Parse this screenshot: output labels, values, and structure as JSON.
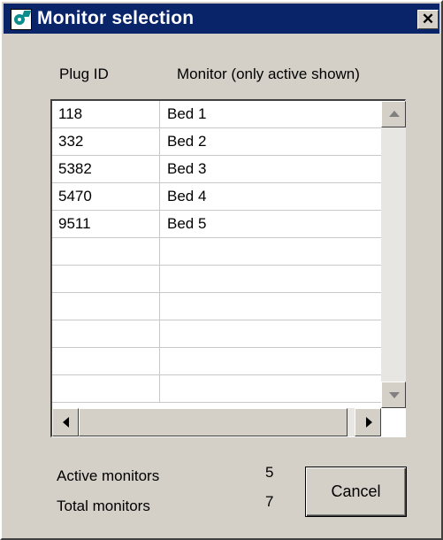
{
  "window": {
    "title": "Monitor selection",
    "close_label": "✕"
  },
  "table": {
    "headers": [
      "Plug ID",
      "Monitor (only active shown)"
    ],
    "rows": [
      {
        "plug_id": "118",
        "monitor": "Bed 1"
      },
      {
        "plug_id": "332",
        "monitor": "Bed 2"
      },
      {
        "plug_id": "5382",
        "monitor": "Bed 3"
      },
      {
        "plug_id": "5470",
        "monitor": "Bed 4"
      },
      {
        "plug_id": "9511",
        "monitor": "Bed 5"
      },
      {
        "plug_id": "",
        "monitor": ""
      },
      {
        "plug_id": "",
        "monitor": ""
      },
      {
        "plug_id": "",
        "monitor": ""
      },
      {
        "plug_id": "",
        "monitor": ""
      },
      {
        "plug_id": "",
        "monitor": ""
      },
      {
        "plug_id": "",
        "monitor": ""
      }
    ]
  },
  "stats": {
    "active_label": "Active monitors",
    "active_value": "5",
    "total_label": "Total monitors",
    "total_value": "7"
  },
  "buttons": {
    "cancel_label": "Cancel"
  },
  "icons": {
    "app": "app-logo-icon",
    "close": "close-icon",
    "scroll_up": "scroll-up-arrow-icon",
    "scroll_down": "scroll-down-arrow-icon",
    "scroll_left": "scroll-left-arrow-icon",
    "scroll_right": "scroll-right-arrow-icon"
  }
}
